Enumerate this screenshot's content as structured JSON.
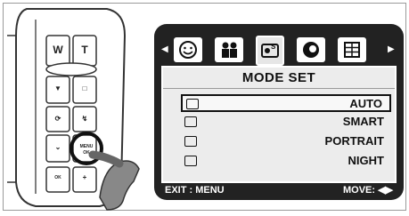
{
  "camera": {
    "buttons": {
      "wide": "W",
      "tele": "T",
      "menu": "MENU",
      "menu_sub": "OK",
      "display": "OK"
    }
  },
  "menu": {
    "title": "MODE SET",
    "tabs": [
      "smiley-tab",
      "people-tab",
      "scene-tab",
      "flower-tab",
      "grid-tab"
    ],
    "active_tab": 2,
    "items": [
      {
        "label": "AUTO",
        "icon": "camera-icon",
        "selected": true
      },
      {
        "label": "SMART",
        "icon": "smart-icon",
        "selected": false
      },
      {
        "label": "PORTRAIT",
        "icon": "portrait-icon",
        "selected": false
      },
      {
        "label": "NIGHT",
        "icon": "night-icon",
        "selected": false
      }
    ],
    "footer": {
      "exit": "EXIT : MENU",
      "move": "MOVE: ◀▶"
    }
  },
  "colors": {
    "lcd_bg": "#222222",
    "panel_bg": "#ececec",
    "text": "#111111"
  }
}
